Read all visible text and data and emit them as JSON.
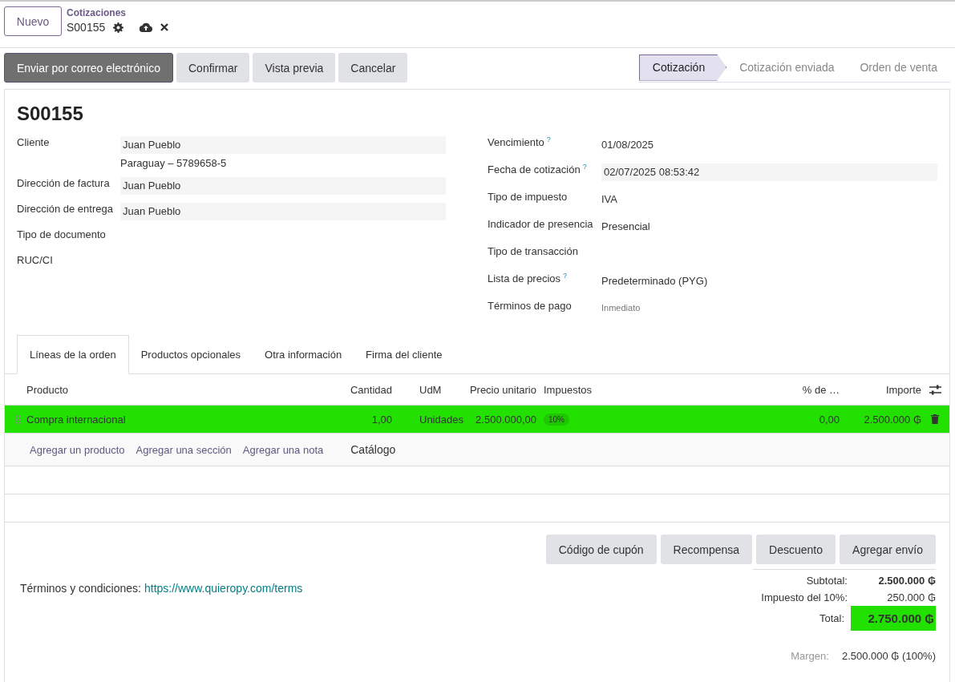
{
  "breadcrumb": {
    "new_button": "Nuevo",
    "parent": "Cotizaciones",
    "current": "S00155"
  },
  "actions": [
    {
      "label": "Enviar por correo electrónico",
      "primary": true
    },
    {
      "label": "Confirmar",
      "primary": false
    },
    {
      "label": "Vista previa",
      "primary": false
    },
    {
      "label": "Cancelar",
      "primary": false
    }
  ],
  "stages": [
    {
      "label": "Cotización",
      "selected": true
    },
    {
      "label": "Cotización enviada",
      "selected": false
    },
    {
      "label": "Orden de venta",
      "selected": false
    }
  ],
  "record": {
    "title": "S00155"
  },
  "left_fields": [
    {
      "label": "Cliente",
      "kind": "input",
      "value": "Juan Pueblo",
      "detail": "Paraguay – 5789658-5"
    },
    {
      "label": "Dirección de factura",
      "kind": "input",
      "value": "Juan Pueblo"
    },
    {
      "label": "Dirección de entrega",
      "kind": "input",
      "value": "Juan Pueblo"
    },
    {
      "label": "Tipo de documento",
      "kind": "empty"
    },
    {
      "label": "RUC/CI",
      "kind": "empty"
    }
  ],
  "right_fields": [
    {
      "label": "Vencimiento",
      "help": "?",
      "kind": "plain",
      "value": "01/08/2025"
    },
    {
      "label": "Fecha de cotización",
      "help": "?",
      "kind": "input",
      "value": "02/07/2025 08:53:42"
    },
    {
      "label": "Tipo de impuesto",
      "kind": "plain",
      "value": "IVA"
    },
    {
      "label": "Indicador de presencia",
      "kind": "plain",
      "value": "Presencial"
    },
    {
      "label": "Tipo de transacción",
      "kind": "empty"
    },
    {
      "label": "Lista de precios",
      "help": "?",
      "kind": "plain",
      "value": "Predeterminado (PYG)"
    },
    {
      "label": "Términos de pago",
      "kind": "placeholder",
      "value": "Inmediato"
    }
  ],
  "tabs": [
    {
      "label": "Líneas de la orden",
      "selected": true
    },
    {
      "label": "Productos opcionales",
      "selected": false
    },
    {
      "label": "Otra información",
      "selected": false
    },
    {
      "label": "Firma del cliente",
      "selected": false
    }
  ],
  "table": {
    "columns": [
      "Producto",
      "Cantidad",
      "UdM",
      "Precio unitario",
      "Impuestos",
      "% de …",
      "Importe"
    ],
    "rows": [
      {
        "highlighted": true,
        "product": "Compra internacional",
        "quantity": "1,00",
        "uom": "Unidades",
        "price": "2.500.000,00",
        "tax": "10%",
        "discount": "0,00",
        "amount": "2.500.000 ₲"
      }
    ],
    "add_links": [
      "Agregar un producto",
      "Agregar una sección",
      "Agregar una nota"
    ],
    "catalog": "Catálogo"
  },
  "extra_buttons": [
    "Código de cupón",
    "Recompensa",
    "Descuento",
    "Agregar envío"
  ],
  "terms": {
    "label": "Términos y condiciones:",
    "link": "https://www.quieropy.com/terms"
  },
  "totals": [
    {
      "kind": "subtotal",
      "label": "Subtotal:",
      "value": "2.500.000 ₲",
      "highlighted": false
    },
    {
      "kind": "tax",
      "label": "Impuesto del 10%:",
      "value": "250.000 ₲",
      "highlighted": false
    },
    {
      "kind": "total",
      "label": "Total:",
      "value": "2.750.000 ₲",
      "highlighted": true
    }
  ],
  "margin": {
    "label": "Margen:",
    "value": "2.500.000 ₲ (100%)"
  }
}
